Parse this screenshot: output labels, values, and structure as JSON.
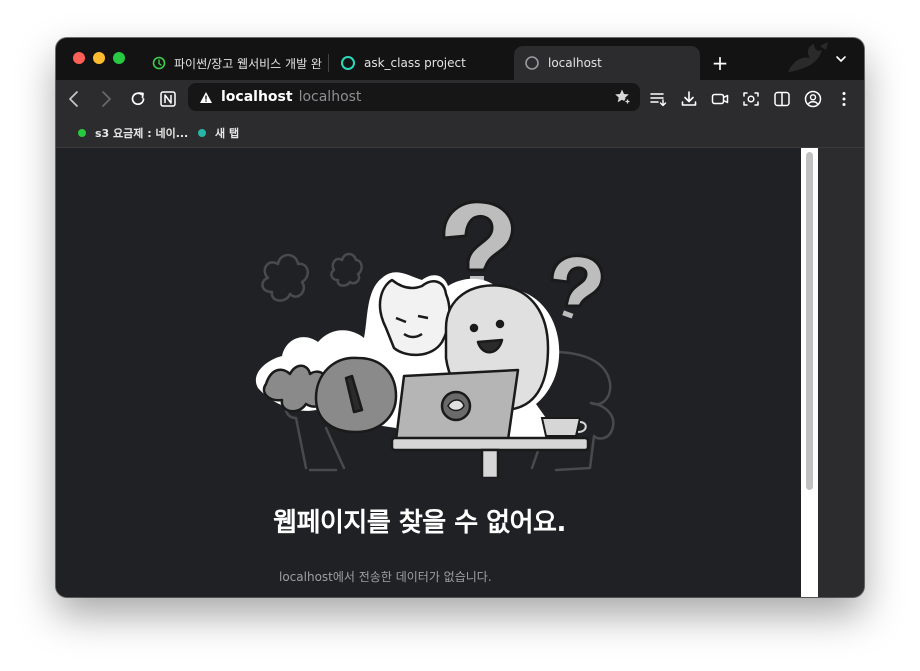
{
  "tabs": [
    {
      "title": "파이썬/장고 웹서비스 개발 완벽",
      "icon": "green-clock-icon"
    },
    {
      "title": "ask_class project",
      "icon": "teal-ring-icon"
    },
    {
      "title": "localhost",
      "icon": "gray-ring-icon",
      "active": true
    }
  ],
  "toolbar": {
    "url_host": "localhost",
    "url_path": "localhost"
  },
  "bookmarks": [
    {
      "label": "s3 요금제 : 네이...",
      "color": "#27c93f"
    },
    {
      "label": "새 탭",
      "color": "#26b5a6"
    }
  ],
  "error": {
    "title": "웹페이지를 찾을 수 없어요.",
    "description": "localhost에서 전송한 데이터가 없습니다."
  },
  "colors": {
    "window_bg": "#1f1f20",
    "tab_strip": "#131314",
    "toolbar": "#2c2c2e",
    "content_bg": "#202124"
  }
}
